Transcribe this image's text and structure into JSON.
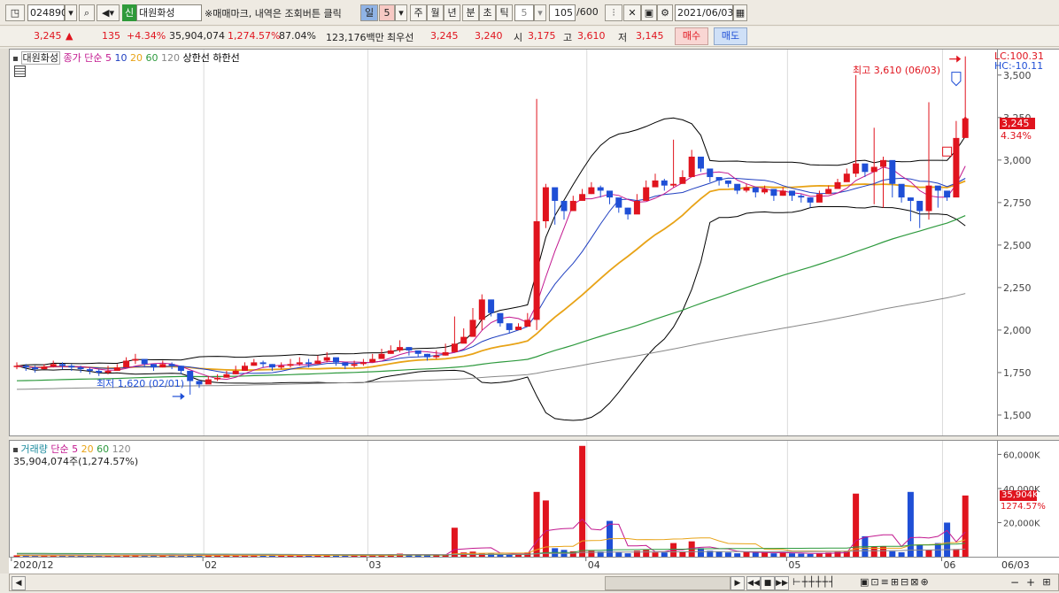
{
  "toolbar": {
    "code": "024890",
    "badge": "신",
    "name": "대원화성",
    "notice": "※매매마크, 내역은 조회버튼 클릭",
    "periods": [
      "일",
      "5",
      "주",
      "월",
      "년",
      "분",
      "초",
      "틱"
    ],
    "count_value": "5",
    "range": "105",
    "range_max": "/600",
    "date": "2021/06/03"
  },
  "info": {
    "price": "3,245",
    "arrow": "▲",
    "change": "135",
    "change_pct": "+4.34%",
    "volume": "35,904,074",
    "volume_pct": "1,274.57%",
    "turnover": "87.04%",
    "amount": "123,176백만",
    "best_label": "최우선",
    "best_ask": "3,245",
    "best_bid": "3,240",
    "open_label": "시",
    "open": "3,175",
    "high_label": "고",
    "high": "3,610",
    "low_label": "저",
    "low": "3,145",
    "buy": "매수",
    "sell": "매도"
  },
  "legend": {
    "name": "대원화성",
    "ma_title": "종가 단순",
    "ma_periods": [
      "5",
      "10",
      "20",
      "60",
      "120"
    ],
    "upper_limit": "상한선",
    "lower_limit": "하한선"
  },
  "annotations": {
    "high": "최고 3,610 (06/03)",
    "low": "최저 1,620 (02/01)",
    "lc": "LC:100.31",
    "hc": "HC:-10.11",
    "price_box": "3,245",
    "pct_box": "4.34%",
    "vol_box": "35,904K",
    "vol_pct_box": "1274.57%"
  },
  "volume_panel": {
    "title": "거래량",
    "ma_title": "단순",
    "ma_periods": [
      "5",
      "20",
      "60",
      "120"
    ],
    "value": "35,904,074주(1,274.57%)"
  },
  "y_ticks": [
    "3,500",
    "3,250",
    "3,000",
    "2,750",
    "2,500",
    "2,250",
    "2,000",
    "1,750",
    "1,500"
  ],
  "vol_ticks": [
    "60,000K",
    "40,000K",
    "20,000K"
  ],
  "x_ticks": [
    "2020/12",
    "02",
    "03",
    "04",
    "05",
    "06",
    "06/03"
  ],
  "colors": {
    "up": "#e0141e",
    "down": "#1f4fd6",
    "ma5": "#c2188f",
    "ma10": "#1f3fc0",
    "ma20": "#e8a317",
    "ma60": "#2e9a3e",
    "ma120": "#888888",
    "band": "#000000"
  },
  "chart_data": {
    "type": "candlestick",
    "start_date": "2020-12-29",
    "count": 105,
    "ylim": [
      1380,
      3650
    ],
    "y_ticks": [
      1500,
      1750,
      2000,
      2250,
      2500,
      2750,
      3000,
      3250,
      3500
    ],
    "x_tick_labels": [
      {
        "label": "2020/12",
        "index": 0
      },
      {
        "label": "02",
        "index": 21
      },
      {
        "label": "03",
        "index": 39
      },
      {
        "label": "04",
        "index": 63
      },
      {
        "label": "05",
        "index": 85
      },
      {
        "label": "06",
        "index": 102
      }
    ],
    "close": [
      1790,
      1780,
      1770,
      1785,
      1800,
      1790,
      1780,
      1770,
      1760,
      1750,
      1760,
      1780,
      1820,
      1830,
      1800,
      1780,
      1800,
      1790,
      1760,
      1700,
      1680,
      1710,
      1720,
      1740,
      1760,
      1790,
      1810,
      1800,
      1780,
      1790,
      1800,
      1810,
      1800,
      1820,
      1840,
      1810,
      1790,
      1800,
      1810,
      1830,
      1860,
      1880,
      1900,
      1880,
      1860,
      1840,
      1850,
      1870,
      1920,
      1960,
      2060,
      2180,
      2100,
      2040,
      2000,
      2020,
      2060,
      2640,
      2840,
      2760,
      2700,
      2760,
      2800,
      2840,
      2820,
      2780,
      2720,
      2680,
      2760,
      2840,
      2880,
      2850,
      2860,
      2900,
      3020,
      2950,
      2900,
      2880,
      2860,
      2820,
      2840,
      2810,
      2830,
      2790,
      2820,
      2790,
      2780,
      2750,
      2800,
      2830,
      2870,
      2920,
      2980,
      2930,
      2960,
      3000,
      2860,
      2780,
      2760,
      2700,
      2850,
      2820,
      2780,
      3130,
      3245
    ],
    "high": [
      1810,
      1800,
      1790,
      1800,
      1820,
      1810,
      1800,
      1790,
      1780,
      1770,
      1790,
      1800,
      1840,
      1860,
      1820,
      1800,
      1820,
      1810,
      1790,
      1720,
      1710,
      1730,
      1740,
      1760,
      1790,
      1810,
      1830,
      1820,
      1800,
      1810,
      1830,
      1840,
      1830,
      1850,
      1870,
      1830,
      1810,
      1820,
      1830,
      1860,
      1890,
      1910,
      1940,
      1900,
      1880,
      1860,
      1880,
      1920,
      2080,
      2010,
      2130,
      2210,
      2120,
      2070,
      2020,
      2040,
      2100,
      3360,
      2860,
      2780,
      2740,
      2790,
      2830,
      2870,
      2850,
      2800,
      2750,
      2720,
      2800,
      2880,
      2920,
      2890,
      3120,
      2940,
      3060,
      2980,
      2920,
      2900,
      2880,
      2850,
      2860,
      2830,
      2850,
      2810,
      2840,
      2810,
      2800,
      2780,
      2820,
      2850,
      2890,
      2950,
      3500,
      2950,
      3190,
      3020,
      2880,
      2820,
      2780,
      2720,
      3340,
      2840,
      2800,
      3230,
      3610
    ],
    "low": [
      1770,
      1760,
      1750,
      1770,
      1780,
      1770,
      1760,
      1750,
      1740,
      1730,
      1740,
      1760,
      1790,
      1800,
      1780,
      1760,
      1780,
      1770,
      1740,
      1620,
      1660,
      1690,
      1700,
      1720,
      1740,
      1770,
      1790,
      1780,
      1760,
      1770,
      1780,
      1790,
      1780,
      1800,
      1810,
      1790,
      1770,
      1780,
      1790,
      1810,
      1840,
      1860,
      1870,
      1850,
      1840,
      1820,
      1830,
      1850,
      1890,
      1940,
      2040,
      2000,
      2080,
      2020,
      1980,
      2000,
      2040,
      2000,
      2600,
      2620,
      2650,
      2720,
      2770,
      2800,
      2780,
      2740,
      2690,
      2650,
      2720,
      2800,
      2850,
      2820,
      2840,
      2860,
      2900,
      2930,
      2870,
      2850,
      2840,
      2800,
      2810,
      2780,
      2800,
      2760,
      2790,
      2760,
      2750,
      2720,
      2770,
      2800,
      2840,
      2880,
      2900,
      2900,
      2740,
      2720,
      2780,
      2750,
      2640,
      2600,
      2650,
      2720,
      2760,
      3060,
      3145
    ],
    "volume": [
      800,
      700,
      600,
      650,
      700,
      600,
      550,
      500,
      600,
      550,
      500,
      600,
      900,
      1000,
      700,
      600,
      700,
      650,
      800,
      1500,
      900,
      700,
      600,
      650,
      700,
      800,
      900,
      750,
      600,
      650,
      700,
      750,
      650,
      800,
      900,
      700,
      600,
      650,
      700,
      900,
      1200,
      1500,
      1800,
      1200,
      900,
      800,
      900,
      1300,
      17000,
      2500,
      3000,
      2000,
      1800,
      1500,
      1200,
      1400,
      2500,
      38000,
      33000,
      5000,
      4000,
      3200,
      65000,
      3500,
      3000,
      21000,
      2500,
      2000,
      3500,
      4000,
      2500,
      2500,
      8000,
      3000,
      9000,
      5000,
      3500,
      3000,
      2500,
      2000,
      3000,
      2500,
      2500,
      2000,
      2500,
      2000,
      1800,
      1600,
      2000,
      2400,
      2800,
      3000,
      37000,
      12000,
      6000,
      6000,
      3200,
      2600,
      38000,
      7000,
      4000,
      8000,
      20000,
      4500,
      35904
    ]
  }
}
